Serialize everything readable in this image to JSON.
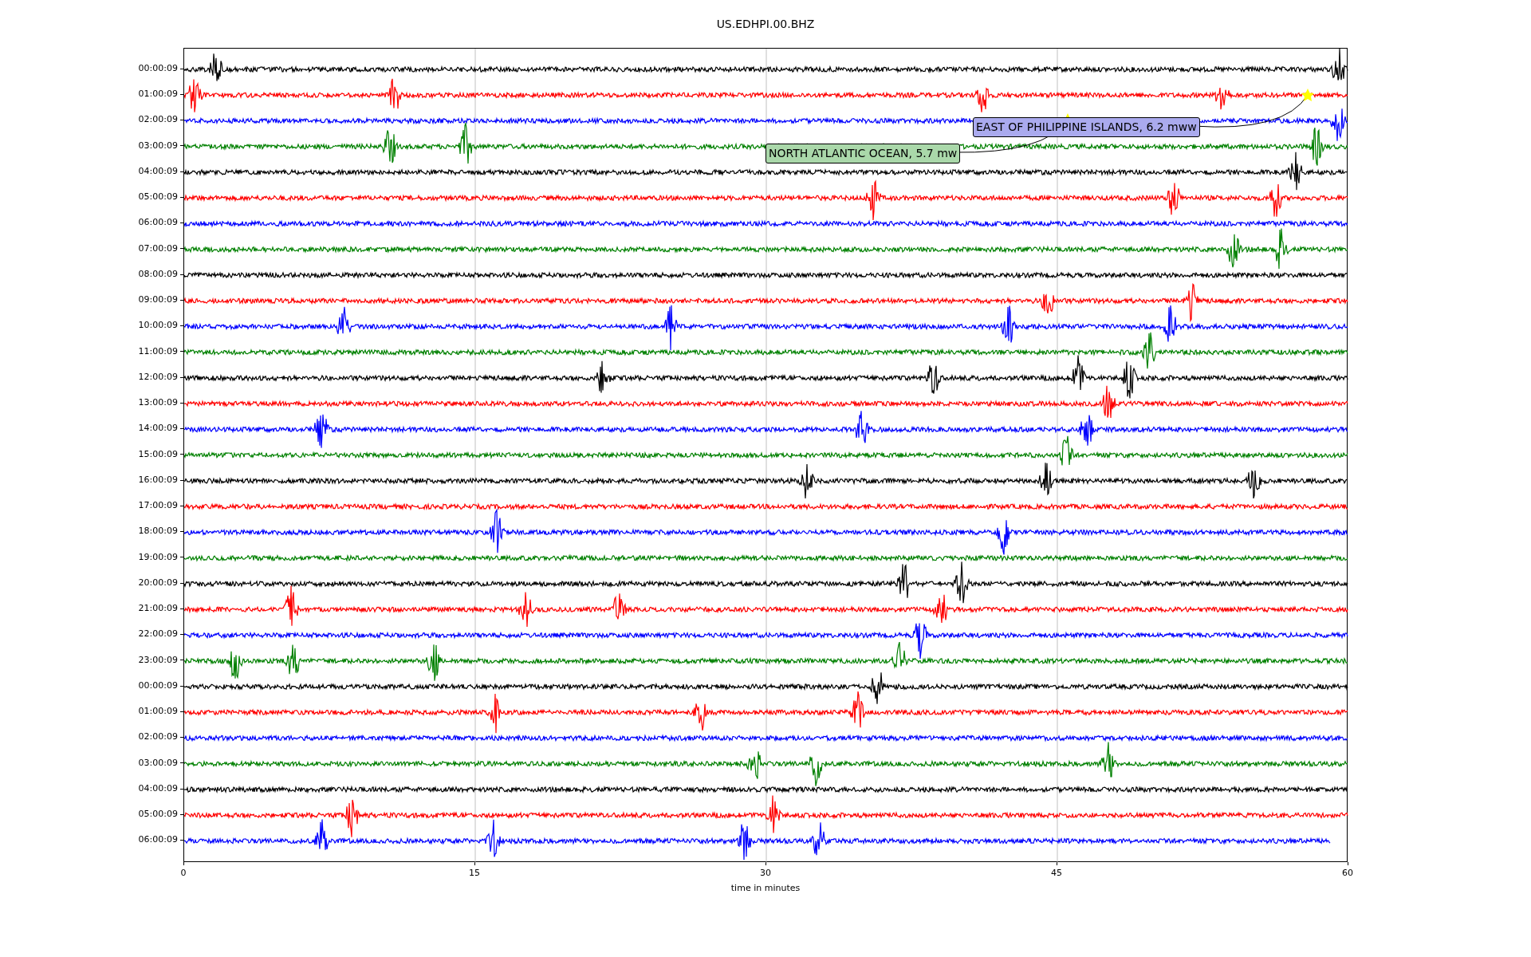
{
  "plot": {
    "title": "US.EDHPI.00.BHZ",
    "xlabel": "time in minutes",
    "x_ticks": [
      "0",
      "15",
      "30",
      "45",
      "60"
    ],
    "rows": [
      {
        "label": "00:00:09",
        "color": "#000000"
      },
      {
        "label": "01:00:09",
        "color": "#ff0000"
      },
      {
        "label": "02:00:09",
        "color": "#0000ff"
      },
      {
        "label": "03:00:09",
        "color": "#008000"
      },
      {
        "label": "04:00:09",
        "color": "#000000"
      },
      {
        "label": "05:00:09",
        "color": "#ff0000"
      },
      {
        "label": "06:00:09",
        "color": "#0000ff"
      },
      {
        "label": "07:00:09",
        "color": "#008000"
      },
      {
        "label": "08:00:09",
        "color": "#000000"
      },
      {
        "label": "09:00:09",
        "color": "#ff0000"
      },
      {
        "label": "10:00:09",
        "color": "#0000ff"
      },
      {
        "label": "11:00:09",
        "color": "#008000"
      },
      {
        "label": "12:00:09",
        "color": "#000000"
      },
      {
        "label": "13:00:09",
        "color": "#ff0000"
      },
      {
        "label": "14:00:09",
        "color": "#0000ff"
      },
      {
        "label": "15:00:09",
        "color": "#008000"
      },
      {
        "label": "16:00:09",
        "color": "#000000"
      },
      {
        "label": "17:00:09",
        "color": "#ff0000"
      },
      {
        "label": "18:00:09",
        "color": "#0000ff"
      },
      {
        "label": "19:00:09",
        "color": "#008000"
      },
      {
        "label": "20:00:09",
        "color": "#000000"
      },
      {
        "label": "21:00:09",
        "color": "#ff0000"
      },
      {
        "label": "22:00:09",
        "color": "#0000ff"
      },
      {
        "label": "23:00:09",
        "color": "#008000"
      },
      {
        "label": "00:00:09",
        "color": "#000000"
      },
      {
        "label": "01:00:09",
        "color": "#ff0000"
      },
      {
        "label": "02:00:09",
        "color": "#0000ff"
      },
      {
        "label": "03:00:09",
        "color": "#008000"
      },
      {
        "label": "04:00:09",
        "color": "#000000"
      },
      {
        "label": "05:00:09",
        "color": "#ff0000"
      },
      {
        "label": "06:00:09",
        "color": "#0000ff"
      }
    ],
    "annotations": [
      {
        "text": "EAST OF PHILIPPINE ISLANDS, 6.2 mww",
        "color": "#aaaaee"
      },
      {
        "text": "NORTH ATLANTIC OCEAN, 5.7 mw",
        "color": "#aad8aa"
      }
    ]
  }
}
